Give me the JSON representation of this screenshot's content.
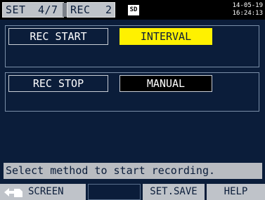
{
  "header": {
    "set_label": "SET",
    "page_indicator": "4/7",
    "rec_label": "REC",
    "rec_number": "2",
    "sd_icon_label": "SD",
    "date": "14-05-19",
    "time": "16:24:13"
  },
  "rec_start": {
    "label": "REC START",
    "value": "INTERVAL"
  },
  "rec_stop": {
    "label": "REC STOP",
    "value": "MANUAL"
  },
  "message": "Select method to start recording.",
  "function_keys": {
    "screen": "SCREEN",
    "set_save": "SET.SAVE",
    "help": "HELP"
  },
  "colors": {
    "background": "#0b1d3a",
    "highlight": "#fff100",
    "tab": "#bfc3c9"
  }
}
